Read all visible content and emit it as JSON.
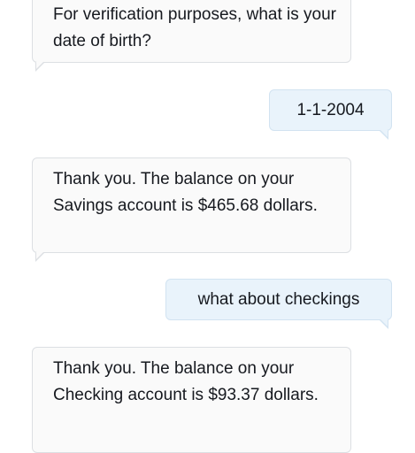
{
  "messages": [
    {
      "sender": "bot",
      "text": "For verification purposes, what is your date of birth?"
    },
    {
      "sender": "user",
      "text": "1-1-2004"
    },
    {
      "sender": "bot",
      "text": "Thank you. The balance on your Savings account is $465.68 dollars."
    },
    {
      "sender": "user",
      "text": "what about checkings"
    },
    {
      "sender": "bot",
      "text": "Thank you. The balance on your Checking account is $93.37 dollars."
    }
  ],
  "colors": {
    "bot_bubble": "#fafafa",
    "bot_border": "#dcdfe3",
    "user_bubble": "#e9f3fb",
    "user_border": "#d2e3f1",
    "text": "#16191f"
  }
}
